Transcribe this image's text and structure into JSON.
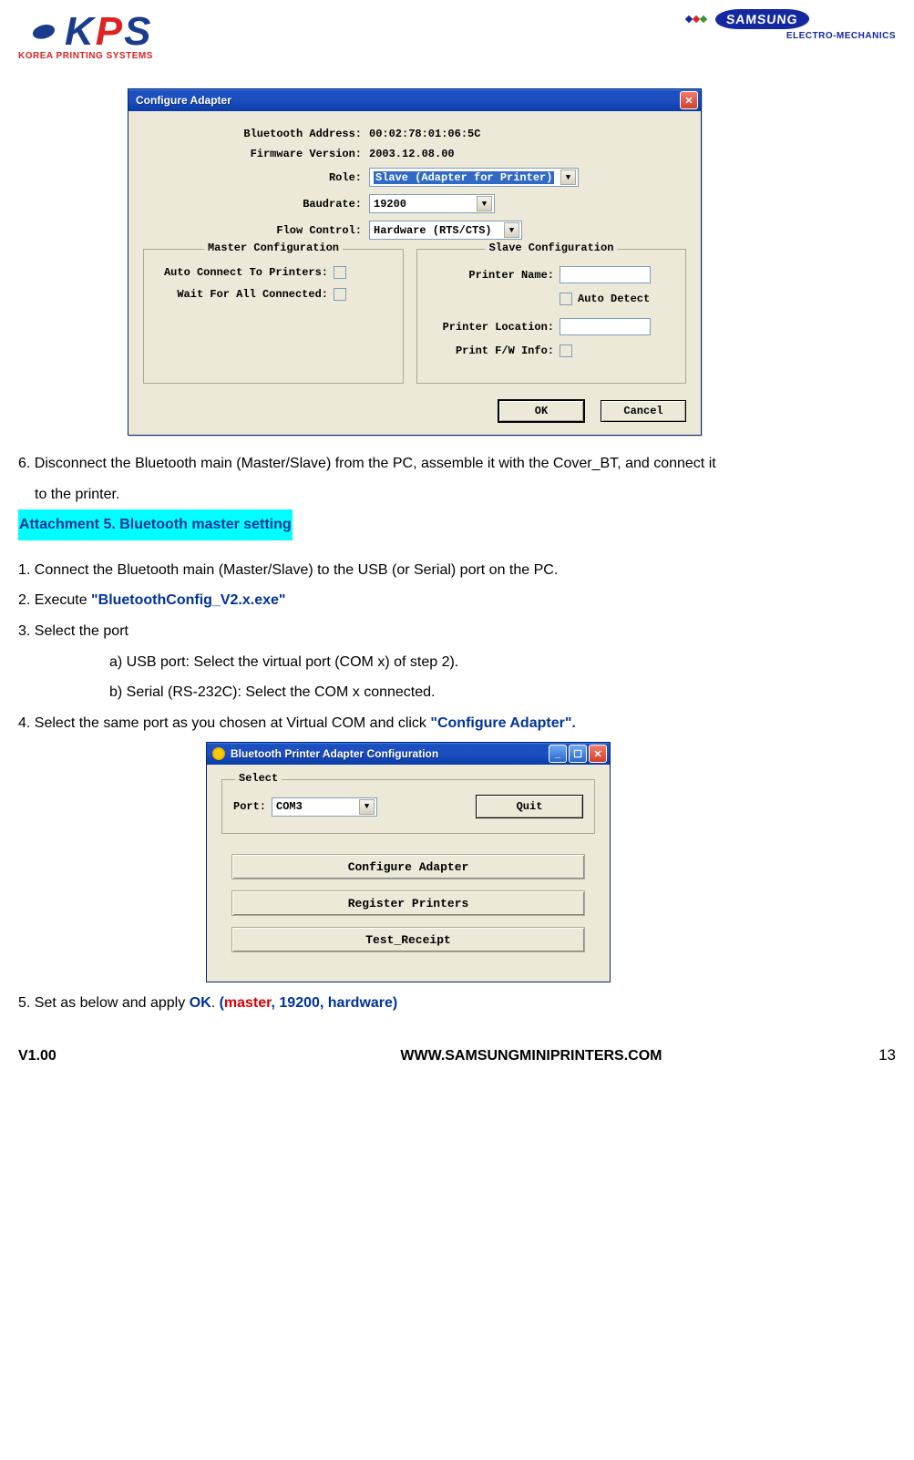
{
  "header": {
    "kps_tag": "KOREA PRINTING SYSTEMS",
    "samsung": "SAMSUNG",
    "em": "ELECTRO-MECHANICS"
  },
  "win1": {
    "title": "Configure Adapter",
    "labels": {
      "bt_addr": "Bluetooth Address:",
      "bt_addr_val": "00:02:78:01:06:5C",
      "fw": "Firmware Version:",
      "fw_val": "2003.12.08.00",
      "role": "Role:",
      "role_val": "Slave  (Adapter for Printer)",
      "baud": "Baudrate:",
      "baud_val": "19200",
      "flow": "Flow Control:",
      "flow_val": "Hardware (RTS/CTS)"
    },
    "master_legend": "Master Configuration",
    "master": {
      "auto_connect": "Auto Connect To Printers:",
      "wait_all": "Wait For All Connected:"
    },
    "slave_legend": "Slave Configuration",
    "slave": {
      "printer_name": "Printer Name:",
      "auto_detect": "Auto Detect",
      "printer_loc": "Printer Location:",
      "fw_info": "Print F/W Info:"
    },
    "ok": "OK",
    "cancel": "Cancel"
  },
  "text": {
    "p6": "6. Disconnect the Bluetooth main (Master/Slave) from the PC, assemble it with the Cover_BT, and connect it",
    "p6b": "to the printer.",
    "attach": "Attachment 5. Bluetooth master setting",
    "p1": "1. Connect the Bluetooth main (Master/Slave) to the USB (or Serial) port on the PC.",
    "p2a": "2. Execute ",
    "p2b": "\"BluetoothConfig_V2.x.exe\"",
    "p3": "3. Select the port",
    "p3a": "a) USB port: Select the virtual port (COM x) of step 2).",
    "p3b": "b) Serial (RS-232C): Select the COM x connected.",
    "p4a": "4. Select the same port as you chosen at Virtual COM and click ",
    "p4b": "\"Configure Adapter\".",
    "p5a": "5. Set as below and apply ",
    "p5b": "OK",
    "p5c": ". ",
    "p5d": "(",
    "p5e": "master",
    "p5f": ", 19200, hardware)"
  },
  "win2": {
    "title": "Bluetooth Printer Adapter Configuration",
    "select_legend": "Select",
    "port_label": "Port:",
    "port_val": "COM3",
    "quit": "Quit",
    "b1": "Configure Adapter",
    "b2": "Register Printers",
    "b3": "Test_Receipt"
  },
  "footer": {
    "ver": "V1.00",
    "url": "WWW.SAMSUNGMINIPRINTERS.COM",
    "page": "13"
  }
}
